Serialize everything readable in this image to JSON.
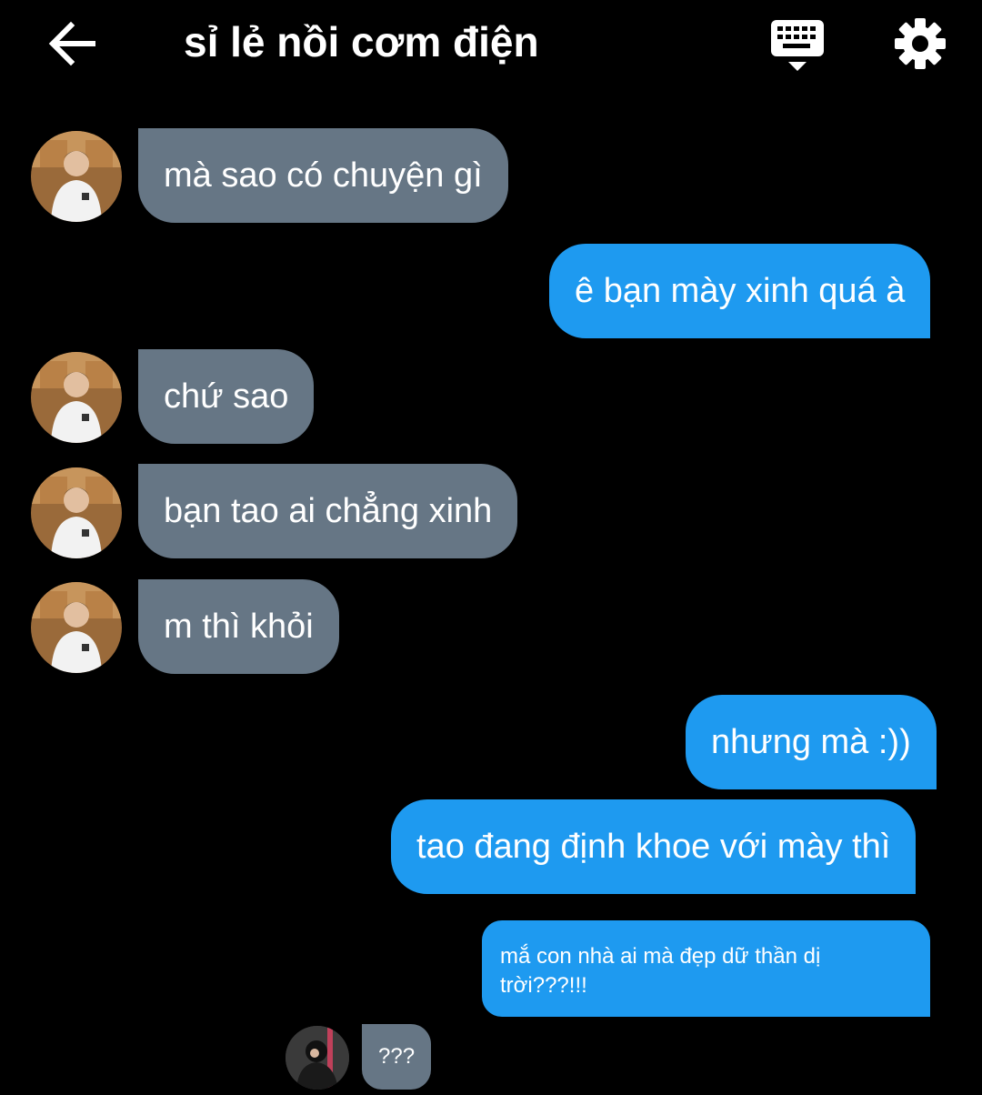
{
  "header": {
    "title": "sỉ lẻ nồi cơm điện",
    "back_icon": "arrow-left-icon",
    "keyboard_icon": "keyboard-icon",
    "settings_icon": "gear-icon"
  },
  "colors": {
    "background": "#000000",
    "incoming_bubble": "#667685",
    "outgoing_bubble": "#1e9af0",
    "text": "#ffffff"
  },
  "messages": [
    {
      "side": "incoming",
      "text": "mà sao có chuyện gì"
    },
    {
      "side": "outgoing",
      "text": "ê bạn mày xinh quá à"
    },
    {
      "side": "incoming",
      "text": "chứ sao"
    },
    {
      "side": "incoming",
      "text": "bạn tao ai chẳng xinh"
    },
    {
      "side": "incoming",
      "text": "m thì khỏi"
    },
    {
      "side": "outgoing",
      "text": "nhưng mà :))"
    },
    {
      "side": "outgoing",
      "text": "tao đang định khoe với mày thì"
    },
    {
      "side": "outgoing",
      "text": "mắ con nhà ai mà đẹp dữ thần dị trời???!!!"
    },
    {
      "side": "incoming",
      "text": "???"
    }
  ]
}
